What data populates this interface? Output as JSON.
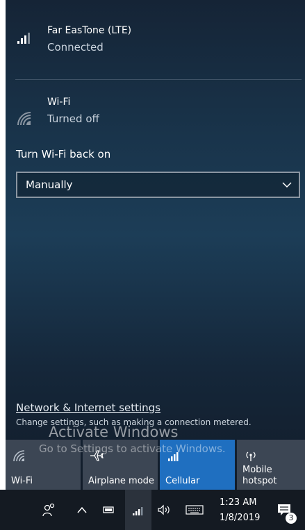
{
  "network_list": {
    "cellular": {
      "name": "Far EasTone (LTE)",
      "status": "Connected",
      "icon": "cellular-signal-icon"
    },
    "wifi": {
      "name": "Wi-Fi",
      "status": "Turned off",
      "icon": "wifi-off-icon"
    }
  },
  "wifi_back_on": {
    "label": "Turn Wi-Fi back on",
    "selected": "Manually"
  },
  "settings": {
    "link": "Network & Internet settings",
    "description": "Change settings, such as making a connection metered."
  },
  "quick_actions": [
    {
      "label": "Wi-Fi",
      "icon": "wifi-icon",
      "active": false
    },
    {
      "label": "Airplane mode",
      "icon": "airplane-icon",
      "active": false
    },
    {
      "label": "Cellular",
      "icon": "cellular-signal-icon",
      "active": true
    },
    {
      "label": "Mobile hotspot",
      "icon": "hotspot-icon",
      "active": false
    }
  ],
  "watermark": {
    "title": "Activate Windows",
    "subtitle": "Go to Settings to activate Windows."
  },
  "taskbar": {
    "time": "1:23 AM",
    "date": "1/8/2019",
    "notification_count": "3"
  },
  "colors": {
    "accent": "#1f6fc0",
    "tile": "#3c4654",
    "taskbar": "#141a22"
  }
}
